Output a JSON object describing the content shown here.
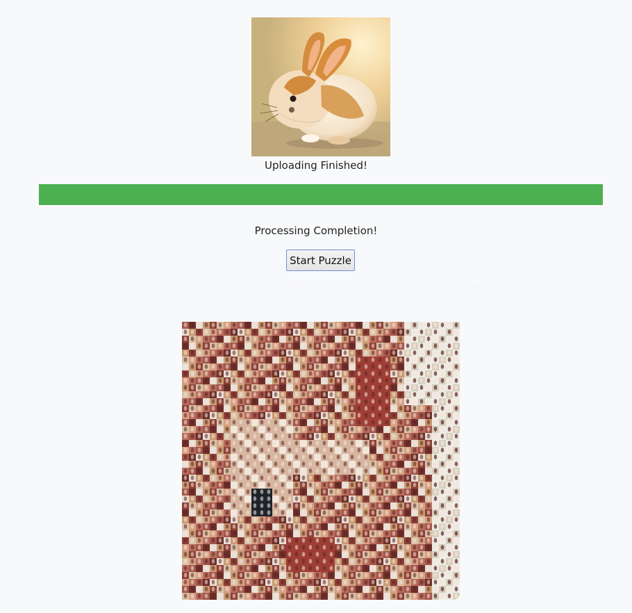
{
  "upload": {
    "status_text": "Uploading Finished!",
    "progress_percent": 100
  },
  "processing": {
    "status_text": "Processing Completion!"
  },
  "puzzle": {
    "start_label": "Start Puzzle"
  },
  "notice": {
    "text": "Due to the capacity limit of the server, the final result is not as good as we expected."
  },
  "colors": {
    "progress": "#4caf50",
    "background": "#f8f9fb",
    "button_border": "#6c8ed8"
  }
}
